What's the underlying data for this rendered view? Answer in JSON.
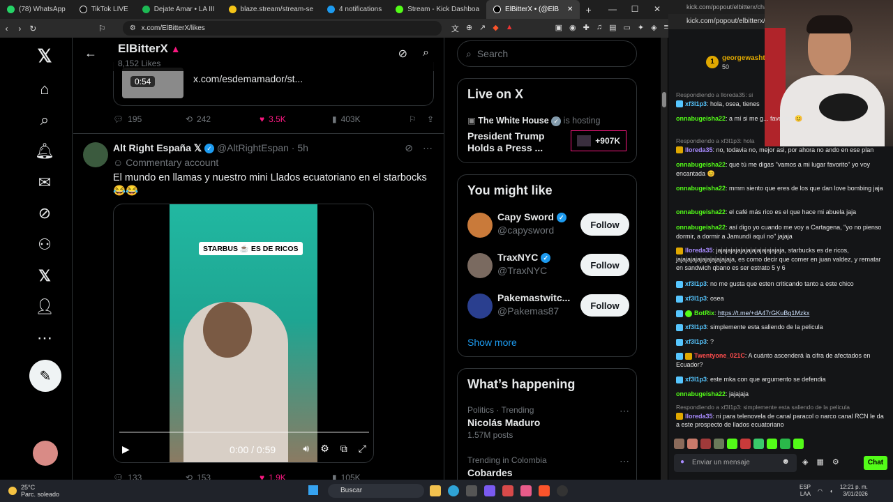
{
  "browser": {
    "tabs": [
      {
        "label": "(78) WhatsApp",
        "color": "#25d366"
      },
      {
        "label": "TikTok LIVE",
        "color": "#ffffff"
      },
      {
        "label": "Dejate Amar • LA III",
        "color": "#1db954"
      },
      {
        "label": "blaze.stream/stream-se",
        "color": "#f5c518"
      },
      {
        "label": "4 notifications",
        "color": "#1d9bf0"
      },
      {
        "label": "Stream - Kick Dashboa",
        "color": "#53fc18"
      },
      {
        "label": "ElBitterX • (@ElB",
        "color": "#ffffff"
      }
    ],
    "url": "x.com/ElBitterX/likes",
    "window_controls": [
      "—",
      "☐",
      "✕"
    ]
  },
  "profile_header": {
    "name": "ElBitterX",
    "subtitle": "8,152 Likes"
  },
  "quoted_card": {
    "duration": "0:54",
    "url": "x.com/esdemamador/st..."
  },
  "tweet1_actions": {
    "replies": "195",
    "retweets": "242",
    "likes": "3.5K",
    "views": "403K"
  },
  "tweet2": {
    "author": "Alt Right España",
    "handle": "@AltRightEspan",
    "time": "· 5h",
    "badge": "Commentary account",
    "text": "El mundo en llamas y nuestro mini Llados ecuatoriano en el starbocks 😂😂",
    "video_caption": "STARBUS ☕ ES DE RICOS",
    "video_time": "0:00 / 0:59"
  },
  "tweet2_actions": {
    "replies": "133",
    "retweets": "153",
    "likes": "1.9K",
    "views": "105K"
  },
  "search_placeholder": "Search",
  "live": {
    "title": "Live on X",
    "host": "The White House",
    "hosting": "is hosting",
    "event": "President Trump Holds a Press ...",
    "count": "+907K"
  },
  "suggest": {
    "title": "You might like",
    "items": [
      {
        "name": "Capy Sword",
        "handle": "@capysword",
        "follow": "Follow",
        "color": "#c97a3a"
      },
      {
        "name": "TraxNYC",
        "handle": "@TraxNYC",
        "follow": "Follow",
        "color": "#7a6a60"
      },
      {
        "name": "Pakemastwitc...",
        "handle": "@Pakemas87",
        "follow": "Follow",
        "color": "#2a3f8f"
      }
    ],
    "show_more": "Show more"
  },
  "happening": {
    "title": "What’s happening",
    "trends": [
      {
        "context": "Politics · Trending",
        "topic": "Nicolás Maduro",
        "posts": "1.57M posts"
      },
      {
        "context": "Trending in Colombia",
        "topic": "Cobardes",
        "posts": ""
      }
    ]
  },
  "kick": {
    "top": "kick.com/popout/elbitterx/chat - ...",
    "url": "kick.com/popout/elbitterx/ch",
    "pinned_user": "georgewasht",
    "pinned_amount": "50",
    "input_placeholder": "Enviar un mensaje",
    "chat_button": "Chat",
    "messages": [
      {
        "reply": "Respondiendo a lloreda35: si",
        "user": "xf3l1p3",
        "color": "blue",
        "text": "hola, osea, tienes"
      },
      {
        "reply": "",
        "user": "onnabugeisha22",
        "color": "green",
        "text": "a mí si me g... favorito\" 😊"
      },
      {
        "reply": "Respondiendo a xf3l1p3: hola",
        "user": "lloreda35",
        "color": "purple",
        "text": "no, todavia no, mejor asi, por ahora no ando en ese plan"
      },
      {
        "reply": "",
        "user": "onnabugeisha22",
        "color": "green",
        "text": "que tú me digas \"vamos a mi lugar favorito\" yo voy encantada 😊"
      },
      {
        "reply": "",
        "user": "onnabugeisha22",
        "color": "green",
        "text": "mmm siento que eres de los que dan love bombing jaja"
      },
      {
        "reply": "",
        "user": "onnabugeisha22",
        "color": "green",
        "text": "el café más rico es el que hace mi abuela jaja"
      },
      {
        "reply": "",
        "user": "onnabugeisha22",
        "color": "green",
        "text": "así digo yo cuando me voy a Cartagena, \"yo no pienso dormir, a dormir a Jamundí aquí no\" jajaja"
      },
      {
        "reply": "",
        "user": "lloreda35",
        "color": "purple",
        "text": "jajajajajajajajajajajajajaja, starbucks es de ricos, jajajajajajajajajajajaja, es como decir que comer en juan valdez, y rematar en sandwich qbano es ser estrato 5 y 6"
      },
      {
        "reply": "",
        "user": "xf3l1p3",
        "color": "blue",
        "text": "no me gusta que esten criticando tanto a este chico"
      },
      {
        "reply": "",
        "user": "xf3l1p3",
        "color": "blue",
        "text": "osea"
      },
      {
        "reply": "",
        "user": "BotRix",
        "color": "green",
        "text": "https://t.me/+dA47rGKuBg1Mzkx"
      },
      {
        "reply": "",
        "user": "xf3l1p3",
        "color": "blue",
        "text": "simplemente esta saliendo de la pelicula"
      },
      {
        "reply": "",
        "user": "xf3l1p3",
        "color": "blue",
        "text": "?"
      },
      {
        "reply": "",
        "user": "Twentyone_021C",
        "color": "red",
        "text": "A cuánto ascenderá la cifra de afectados en Ecuador?"
      },
      {
        "reply": "",
        "user": "xf3l1p3",
        "color": "blue",
        "text": "este mka con que argumento se defendia"
      },
      {
        "reply": "",
        "user": "onnabugeisha22",
        "color": "green",
        "text": "jajajaja"
      },
      {
        "reply": "Respondiendo a xf3l1p3: simplemente esta saliendo de la pelicula",
        "user": "lloreda35",
        "color": "purple",
        "text": "ni para telenovela de canal paracol o narco canal RCN le da a este prospecto de llados ecuatoriano"
      }
    ]
  },
  "taskbar": {
    "temp": "25°C",
    "weather": "Parc. soleado",
    "search": "Buscar",
    "lang": "ESP",
    "lang2": "LAA",
    "time": "12:21 p. m.",
    "date": "3/01/2026"
  }
}
